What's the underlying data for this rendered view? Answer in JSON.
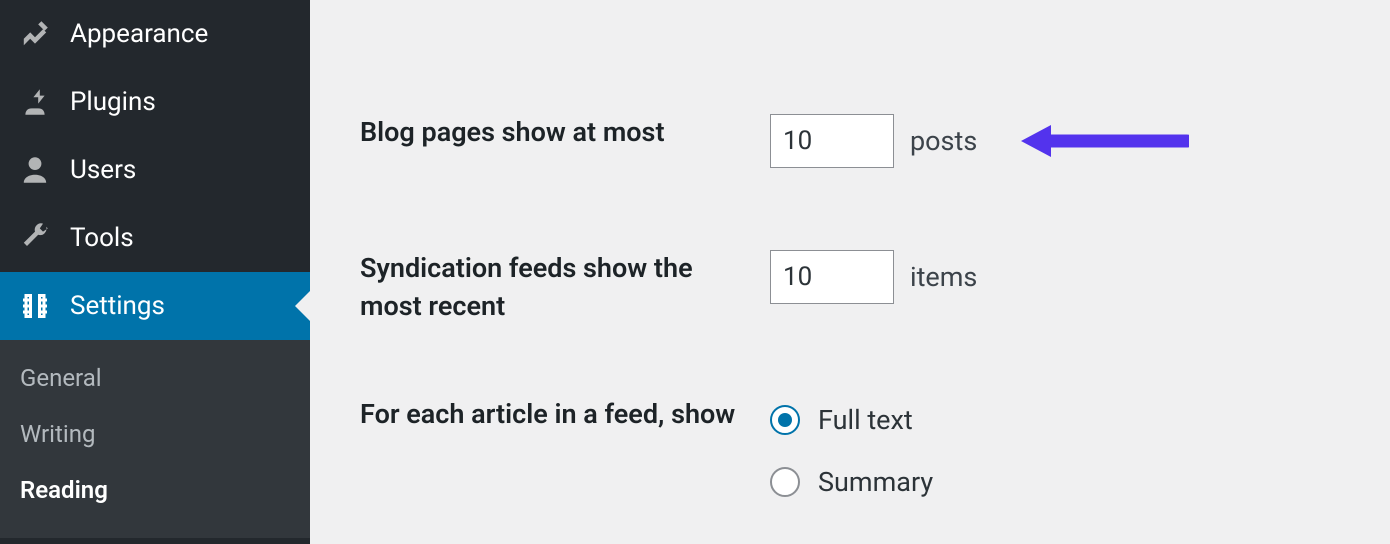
{
  "sidebar": {
    "items": [
      {
        "label": "Appearance"
      },
      {
        "label": "Plugins"
      },
      {
        "label": "Users"
      },
      {
        "label": "Tools"
      },
      {
        "label": "Settings"
      }
    ],
    "submenu": [
      {
        "label": "General"
      },
      {
        "label": "Writing"
      },
      {
        "label": "Reading"
      }
    ]
  },
  "settings": {
    "blog_pages_label": "Blog pages show at most",
    "blog_pages_value": "10",
    "blog_pages_unit": "posts",
    "feeds_label": "Syndication feeds show the most recent",
    "feeds_value": "10",
    "feeds_unit": "items",
    "article_label": "For each article in a feed, show",
    "article_options": {
      "full": "Full text",
      "summary": "Summary"
    }
  },
  "colors": {
    "accent": "#0073aa",
    "arrow": "#5333ed"
  }
}
